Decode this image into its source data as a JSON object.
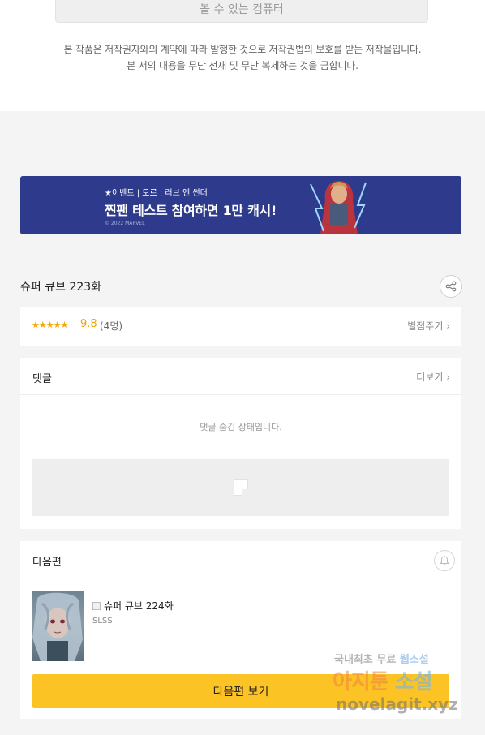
{
  "top_box": {
    "label": "볼 수 있는 컴퓨터"
  },
  "copyright": {
    "line1": "본 작품은 저작권자와의 계약에 따라 발행한 것으로 저작권법의 보호를 받는 저작물입니다.",
    "line2": "본 서의 내용을 무단 전재 및 무단 복제하는 것을 금합니다."
  },
  "banner": {
    "event_line": "★이벤트 | 토르 : 러브 앤 썬더",
    "title": "찐팬 테스트 참여하면 1만 캐시!",
    "copyright": "© 2022 MARVEL"
  },
  "episode": {
    "title": "슈퍼 큐브 223화"
  },
  "rating": {
    "stars": "★★★★★",
    "score": "9.8",
    "count": "(4명)",
    "rate_link": "별점주기 ›"
  },
  "comments": {
    "header": "댓글",
    "more": "더보기 ›",
    "hidden_message": "댓글 숨김 상태입니다."
  },
  "next_episode": {
    "header": "다음편",
    "title": "슈퍼 큐브 224화",
    "author": "SLSS",
    "button": "다음편 보기"
  },
  "watermark": {
    "line1_a": "국내최초 무료",
    "line1_b": "웹소설",
    "line2_a": "아지툰",
    "line2_b": "소설",
    "line3": "novelagit.xyz"
  },
  "icons": {
    "share": "share-icon",
    "bell": "bell-icon"
  },
  "colors": {
    "banner_bg": "#2e3a8c",
    "star": "#f2a600",
    "next_button": "#fcc325"
  }
}
